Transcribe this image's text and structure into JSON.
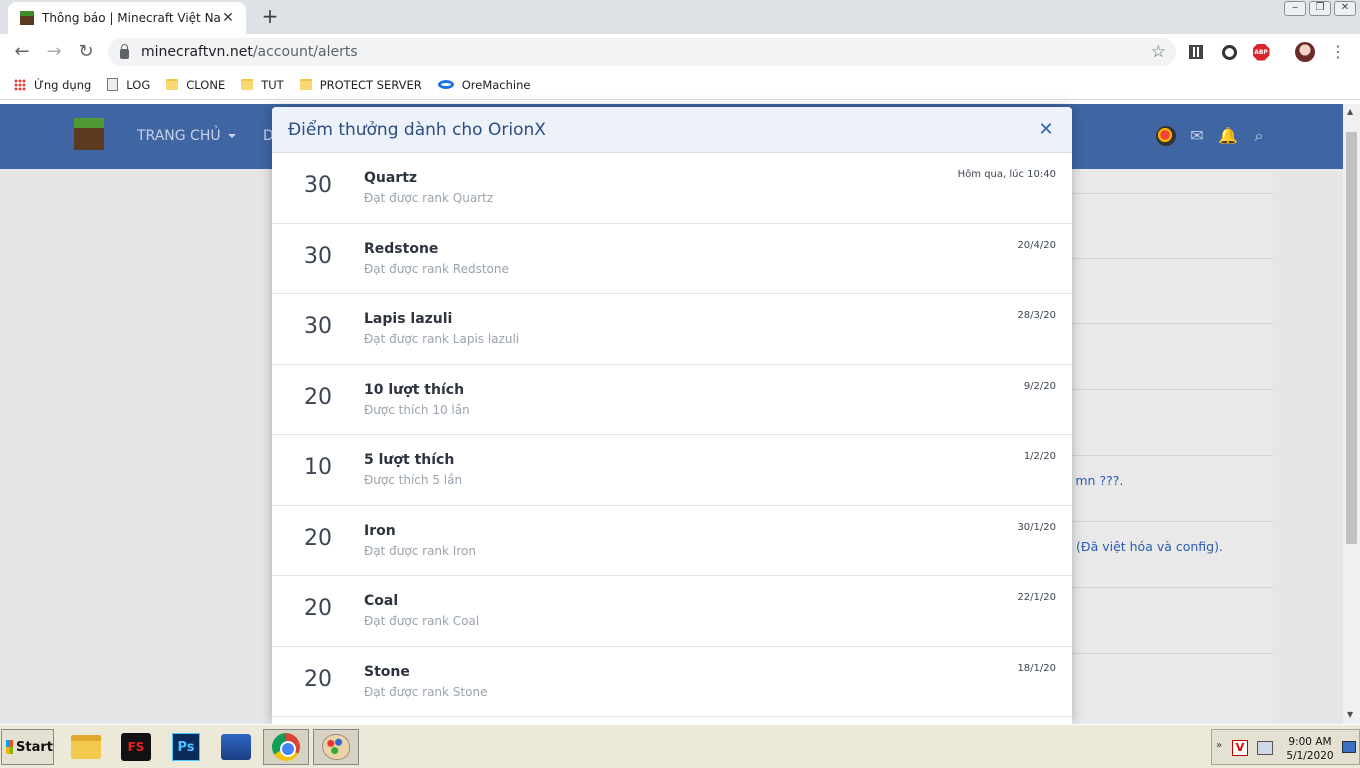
{
  "browser": {
    "tab": {
      "title": "Thông báo | Minecraft Việt Nam",
      "close": "✕"
    },
    "new_tab": "+",
    "window_controls": [
      "‒",
      "❐",
      "✕"
    ],
    "nav": {
      "back": "←",
      "forward": "→",
      "reload": "↻"
    },
    "url": {
      "host": "minecraftvn.net",
      "path": "/account/alerts"
    },
    "star": "☆",
    "menu": "⋮",
    "extensions": {
      "abp_label": "ABP"
    }
  },
  "bookmarks": [
    {
      "label": "Ứng dụng",
      "icon": "apps-grid-icon"
    },
    {
      "label": "LOG",
      "icon": "page-icon"
    },
    {
      "label": "CLONE",
      "icon": "folder-icon"
    },
    {
      "label": "TUT",
      "icon": "folder-icon"
    },
    {
      "label": "PROTECT SERVER",
      "icon": "folder-icon"
    },
    {
      "label": "OreMachine",
      "icon": "oremachine-icon"
    }
  ],
  "site": {
    "nav_home": "TRANG CHỦ",
    "nav_next": "D",
    "header_icons": {
      "mail": "✉",
      "bell": "🔔",
      "search": "⌕"
    },
    "bg_links": [
      "y mn ???.",
      "(Đã việt hóa và config)."
    ]
  },
  "dialog": {
    "title": "Điểm thưởng dành cho OrionX",
    "close": "✕",
    "trophies": [
      {
        "points": "30",
        "name": "Quartz",
        "desc": "Đạt được rank Quartz",
        "date": "Hôm qua, lúc 10:40"
      },
      {
        "points": "30",
        "name": "Redstone",
        "desc": "Đạt được rank Redstone",
        "date": "20/4/20"
      },
      {
        "points": "30",
        "name": "Lapis lazuli",
        "desc": "Đạt được rank Lapis lazuli",
        "date": "28/3/20"
      },
      {
        "points": "20",
        "name": "10 lượt thích",
        "desc": "Được thích 10 lần",
        "date": "9/2/20"
      },
      {
        "points": "10",
        "name": "5 lượt thích",
        "desc": "Được thích 5 lần",
        "date": "1/2/20"
      },
      {
        "points": "20",
        "name": "Iron",
        "desc": "Đạt được rank Iron",
        "date": "30/1/20"
      },
      {
        "points": "20",
        "name": "Coal",
        "desc": "Đạt được rank Coal",
        "date": "22/1/20"
      },
      {
        "points": "20",
        "name": "Stone",
        "desc": "Đạt được rank Stone",
        "date": "18/1/20"
      }
    ]
  },
  "taskbar": {
    "start": "Start",
    "apps": [
      "file-explorer-icon",
      "fsviewer-icon",
      "photoshop-icon",
      "network-icon",
      "chrome-icon",
      "paint-icon"
    ],
    "fs_label": "FS",
    "ps_label": "Ps",
    "tray": {
      "chevron": "»",
      "v_label": "V",
      "time": "9:00 AM",
      "date": "5/1/2020"
    }
  },
  "colors": {
    "site_header": "#3f65a3",
    "dialog_header": "#edf2fa",
    "link": "#2a5bb0"
  }
}
